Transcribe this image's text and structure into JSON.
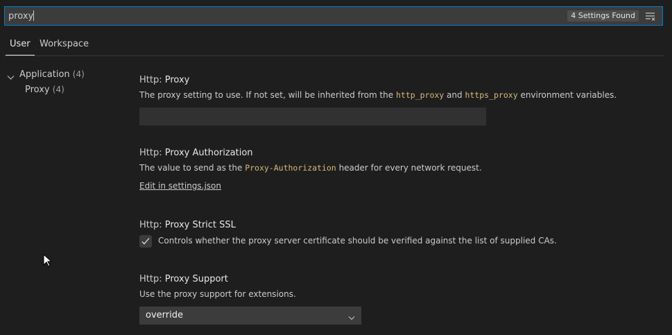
{
  "search": {
    "value": "proxy",
    "result_count": "4 Settings Found",
    "clear_icon": "clear-filter-icon"
  },
  "tabs": [
    {
      "label": "User",
      "active": true
    },
    {
      "label": "Workspace",
      "active": false
    }
  ],
  "toc": {
    "application": {
      "label": "Application",
      "count": "(4)"
    },
    "proxy": {
      "label": "Proxy",
      "count": "(4)"
    }
  },
  "settings": {
    "proxy": {
      "category": "Http: ",
      "label": "Proxy",
      "desc_before": "The proxy setting to use. If not set, will be inherited from the ",
      "code1": "http_proxy",
      "desc_mid": " and ",
      "code2": "https_proxy",
      "desc_after": " environment variables.",
      "value": ""
    },
    "proxy_authorization": {
      "category": "Http: ",
      "label": "Proxy Authorization",
      "desc_before": "The value to send as the ",
      "code": "Proxy-Authorization",
      "desc_after": " header for every network request.",
      "link": "Edit in settings.json"
    },
    "proxy_strict_ssl": {
      "category": "Http: ",
      "label": "Proxy Strict SSL",
      "checked": true,
      "desc": "Controls whether the proxy server certificate should be verified against the list of supplied CAs."
    },
    "proxy_support": {
      "category": "Http: ",
      "label": "Proxy Support",
      "desc": "Use the proxy support for extensions.",
      "value": "override"
    }
  },
  "colors": {
    "background": "#1e1e1e",
    "input_background": "#3c3c3c",
    "focus_border": "#007fd4",
    "code_text": "#d7ba7d"
  }
}
